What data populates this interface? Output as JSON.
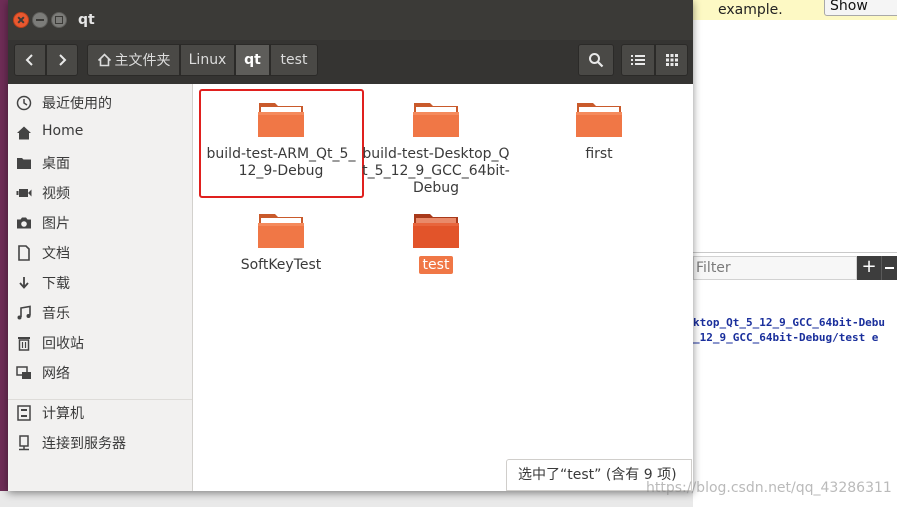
{
  "window": {
    "title": "qt"
  },
  "breadcrumb": [
    "主文件夹",
    "Linux",
    "qt",
    "test"
  ],
  "sidebar": {
    "items": [
      {
        "label": "最近使用的",
        "icon": "recent-icon"
      },
      {
        "label": "Home",
        "icon": "home-icon"
      },
      {
        "label": "桌面",
        "icon": "folder-icon"
      },
      {
        "label": "视频",
        "icon": "video-icon"
      },
      {
        "label": "图片",
        "icon": "camera-icon"
      },
      {
        "label": "文档",
        "icon": "document-icon"
      },
      {
        "label": "下载",
        "icon": "download-icon"
      },
      {
        "label": "音乐",
        "icon": "music-icon"
      },
      {
        "label": "回收站",
        "icon": "trash-icon"
      },
      {
        "label": "网络",
        "icon": "network-icon"
      }
    ],
    "devices": [
      {
        "label": "计算机",
        "icon": "computer-icon"
      },
      {
        "label": "连接到服务器",
        "icon": "server-icon"
      }
    ]
  },
  "files": [
    {
      "name": "build-test-ARM_Qt_5_12_9-Debug",
      "highlighted": true,
      "selected": false
    },
    {
      "name": "build-test-Desktop_Qt_5_12_9_GCC_64bit-Debug",
      "highlighted": false,
      "selected": false
    },
    {
      "name": "first",
      "highlighted": false,
      "selected": false
    },
    {
      "name": "SoftKeyTest",
      "highlighted": false,
      "selected": false
    },
    {
      "name": "test",
      "highlighted": false,
      "selected": true
    }
  ],
  "status": "选中了“test” (含有 9 项)",
  "background_app": {
    "top_text": "example.",
    "show_details": "Show Deta",
    "filter_placeholder": "Filter",
    "plus": "+",
    "output_lines": [
      "ktop_Qt_5_12_9_GCC_64bit-Debu",
      "_12_9_GCC_64bit-Debug/test e"
    ]
  },
  "watermark": "https://blog.csdn.net/qq_43286311",
  "colors": {
    "folder": "#f07746",
    "folder_selected": "#e2542a",
    "highlight_box": "#e0201e",
    "titlebar": "#3b3a37"
  }
}
